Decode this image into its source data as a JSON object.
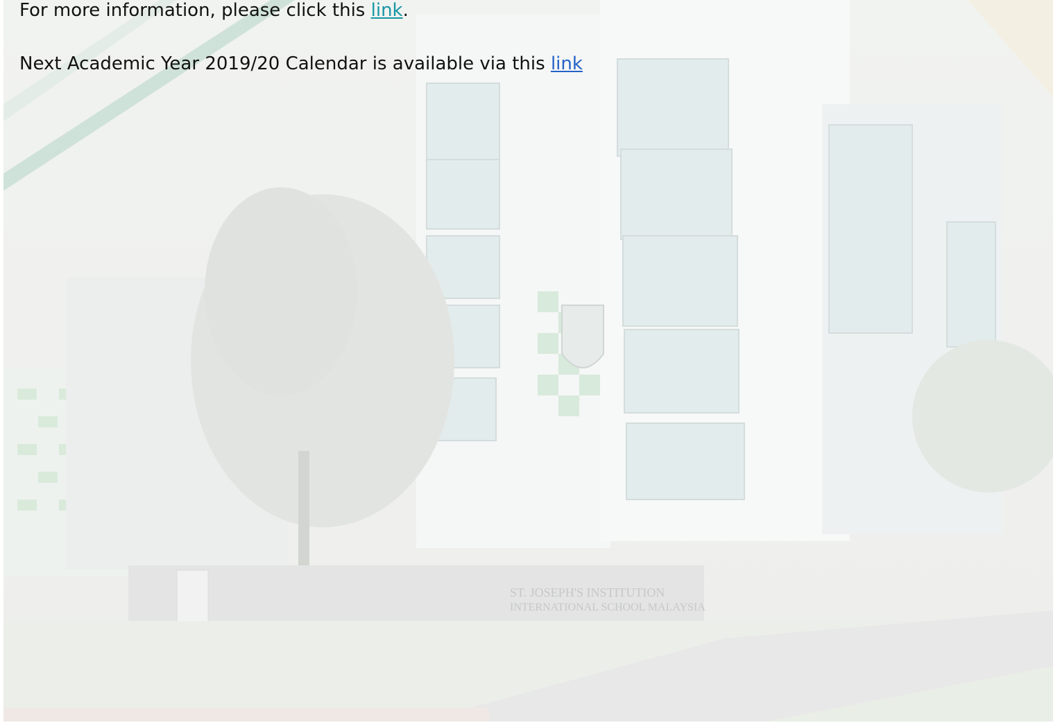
{
  "content": {
    "info_line": {
      "prefix": "For more information, please click this ",
      "link_text": "link",
      "suffix": "."
    },
    "calendar_line": {
      "prefix": "Next Academic Year 2019/20 Calendar is available via this ",
      "link_text": "link"
    }
  },
  "background": {
    "sign_line1": "ST. JOSEPH'S INSTITUTION",
    "sign_line2": "INTERNATIONAL SCHOOL MALAYSIA"
  },
  "colors": {
    "link_primary": "#1796a4",
    "link_secondary": "#2462c7",
    "text": "#111111"
  }
}
